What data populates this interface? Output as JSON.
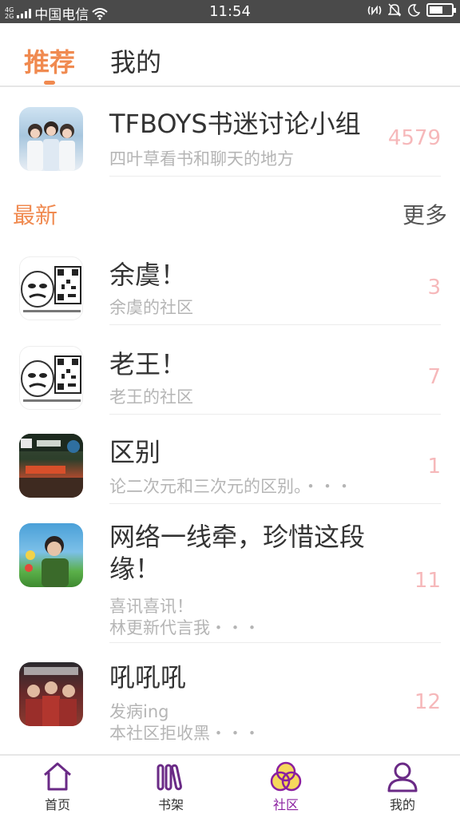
{
  "status_bar": {
    "net_type_top": "4G",
    "net_type_bottom": "2G",
    "carrier": "中国电信",
    "time": "11:54",
    "icons": [
      "wifi-icon",
      "nfc-icon",
      "mute-icon",
      "moon-icon",
      "battery-icon"
    ],
    "battery_level": 0.6
  },
  "tabs": [
    {
      "label": "推荐",
      "active": true
    },
    {
      "label": "我的",
      "active": false
    }
  ],
  "featured": {
    "title": "TFBOYS书迷讨论小组",
    "description": "四叶草看书和聊天的地方",
    "count": "4579"
  },
  "section": {
    "title": "最新",
    "more_label": "更多"
  },
  "communities": [
    {
      "title": "余虞！",
      "description": "余虞的社区",
      "count": "3"
    },
    {
      "title": "老王！",
      "description": "老王的社区",
      "count": "7"
    },
    {
      "title": "区别",
      "description": "论二次元和三次元的区别。・・・",
      "count": "1"
    },
    {
      "title": "网络一线牵，珍惜这段\n缘！",
      "description": "喜讯喜讯！\n林更新代言我・・・",
      "count": "11"
    },
    {
      "title": "吼吼吼",
      "description": "发病ing\n本社区拒收黑・・・",
      "count": "12"
    }
  ],
  "bottom_nav": [
    {
      "label": "首页",
      "icon": "home-icon",
      "active": false
    },
    {
      "label": "书架",
      "icon": "bookshelf-icon",
      "active": false
    },
    {
      "label": "社区",
      "icon": "community-icon",
      "active": true
    },
    {
      "label": "我的",
      "icon": "profile-icon",
      "active": false
    }
  ],
  "colors": {
    "accent": "#f08a50",
    "count": "#f6b8ba",
    "nav_icon": "#6a2a86",
    "nav_active": "#8a1fa0",
    "status_bar": "#4a4a4a"
  }
}
